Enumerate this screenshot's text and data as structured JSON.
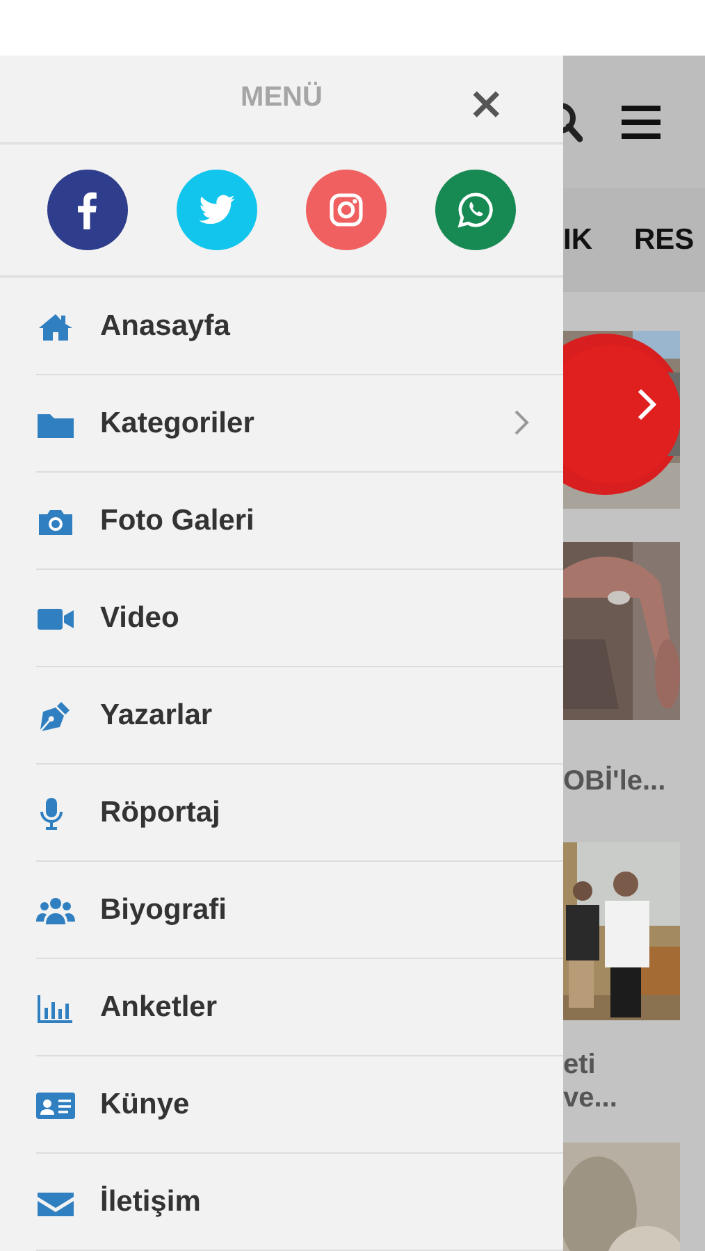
{
  "drawer": {
    "title": "MENÜ",
    "close": "×",
    "social": [
      {
        "kind": "facebook",
        "color": "#2e3d8c"
      },
      {
        "kind": "twitter",
        "color": "#12c5ec"
      },
      {
        "kind": "instagram",
        "color": "#f06060"
      },
      {
        "kind": "whatsapp",
        "color": "#178a53"
      }
    ],
    "items": [
      {
        "label": "Anasayfa",
        "kind": "home",
        "expandable": false
      },
      {
        "label": "Kategoriler",
        "kind": "folder",
        "expandable": true
      },
      {
        "label": "Foto Galeri",
        "kind": "camera",
        "expandable": false
      },
      {
        "label": "Video",
        "kind": "video",
        "expandable": false
      },
      {
        "label": "Yazarlar",
        "kind": "pen",
        "expandable": false
      },
      {
        "label": "Röportaj",
        "kind": "mic",
        "expandable": false
      },
      {
        "label": "Biyografi",
        "kind": "users",
        "expandable": false
      },
      {
        "label": "Anketler",
        "kind": "chart",
        "expandable": false
      },
      {
        "label": "Künye",
        "kind": "card",
        "expandable": false
      },
      {
        "label": "İletişim",
        "kind": "mail",
        "expandable": false
      }
    ]
  },
  "page": {
    "tabs": [
      "IK",
      "RES"
    ],
    "news": [
      {
        "kind": "picture"
      },
      {
        "kind": "picture"
      },
      {
        "kind": "title",
        "lines": [
          "OBİ'le..."
        ]
      },
      {
        "kind": "picture"
      },
      {
        "kind": "title",
        "lines": [
          "eti",
          " ve..."
        ]
      },
      {
        "kind": "picture"
      }
    ]
  }
}
